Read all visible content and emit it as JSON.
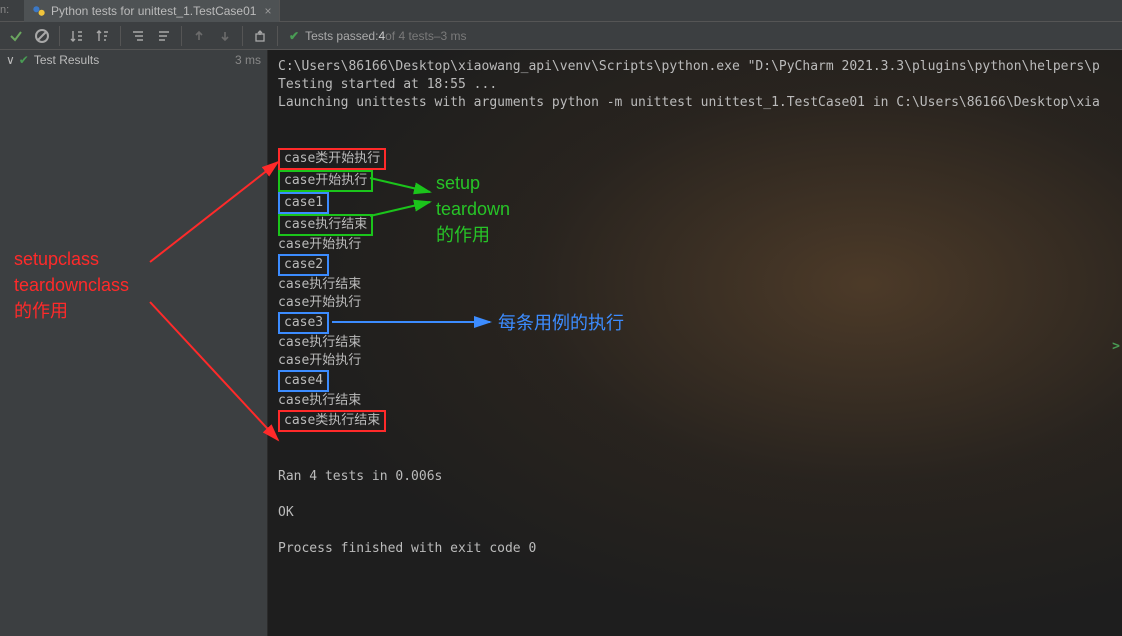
{
  "tab": {
    "title": "Python tests for unittest_1.TestCase01",
    "close": "×"
  },
  "run_label": "n:",
  "toolbar": {
    "tests_passed_prefix": "Tests passed: ",
    "tests_passed_count": "4",
    "tests_passed_of": " of 4 tests",
    "tests_passed_dash": " – ",
    "tests_time": "3 ms"
  },
  "tree": {
    "results_label": "Test Results",
    "results_time": "3 ms"
  },
  "console": {
    "line1": "C:\\Users\\86166\\Desktop\\xiaowang_api\\venv\\Scripts\\python.exe \"D:\\PyCharm 2021.3.3\\plugins\\python\\helpers\\p",
    "line2": "Testing started at 18:55 ...",
    "line3": "Launching unittests with arguments python -m unittest unittest_1.TestCase01 in C:\\Users\\86166\\Desktop\\xia",
    "out": {
      "class_start": "case类开始执行",
      "case_start": "case开始执行",
      "case1": "case1",
      "case_end": "case执行结束",
      "case2": "case2",
      "case3": "case3",
      "case4": "case4",
      "class_end": "case类执行结束"
    },
    "ran": "Ran 4 tests in 0.006s",
    "ok": "OK",
    "finished": "Process finished with exit code 0"
  },
  "annotations": {
    "left1": "setupclass",
    "left2": "teardownclass",
    "left3": "的作用",
    "green1": "setup",
    "green2": "teardown",
    "green3": "的作用",
    "blue": "每条用例的执行"
  }
}
